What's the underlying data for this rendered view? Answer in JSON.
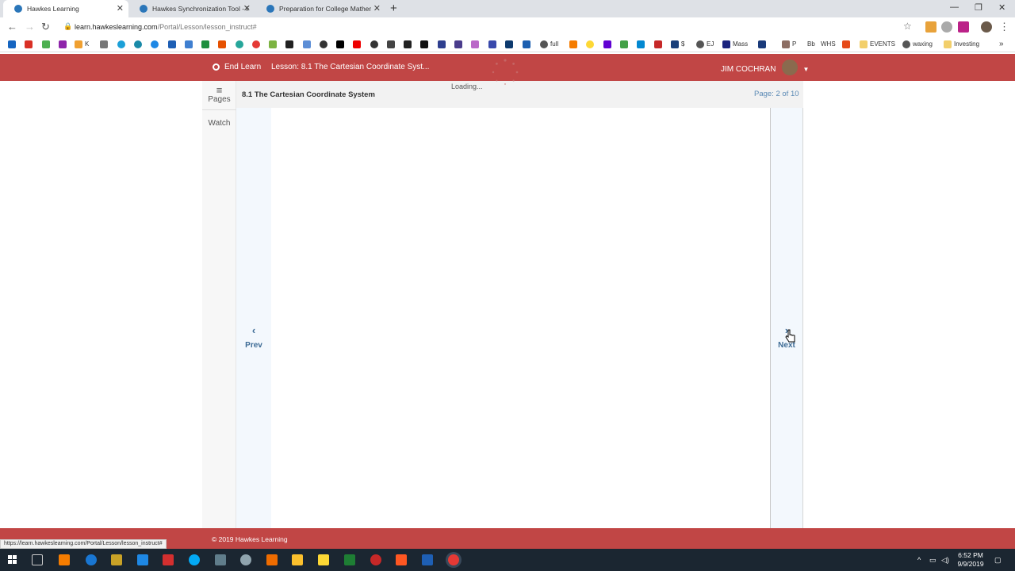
{
  "browser": {
    "tabs": [
      {
        "title": "Hawkes Learning",
        "active": true
      },
      {
        "title": "Hawkes Synchronization Tool - H",
        "active": false
      },
      {
        "title": "Preparation for College Mathema",
        "active": false
      }
    ],
    "url_host": "learn.hawkeslearning.com",
    "url_path": "/Portal/Lesson/lesson_instruct#",
    "bookmarks": [
      "K",
      "full",
      "$",
      "EJ",
      "Mass",
      "P",
      "Bb",
      "WHS",
      "EVENTS",
      "waxing",
      "Investing"
    ],
    "status_url": "https://learn.hawkeslearning.com/Portal/Lesson/lesson_instruct#"
  },
  "header": {
    "end_learn": "End Learn",
    "lesson_title": "Lesson: 8.1 The Cartesian Coordinate Syst...",
    "user_name": "JIM COCHRAN"
  },
  "rail": {
    "pages_label": "Pages",
    "watch_label": "Watch"
  },
  "lesson": {
    "section_title": "8.1 The Cartesian Coordinate System",
    "loading_text": "Loading...",
    "page_indicator": "Page: 2 of 10",
    "prev_label": "Prev",
    "next_label": "Next"
  },
  "footer": {
    "copyright": "© 2019 Hawkes Learning"
  },
  "taskbar": {
    "time": "6:52 PM",
    "date": "9/9/2019"
  },
  "colors": {
    "brand_red": "#c14645",
    "nav_blue": "#3d6b95"
  }
}
